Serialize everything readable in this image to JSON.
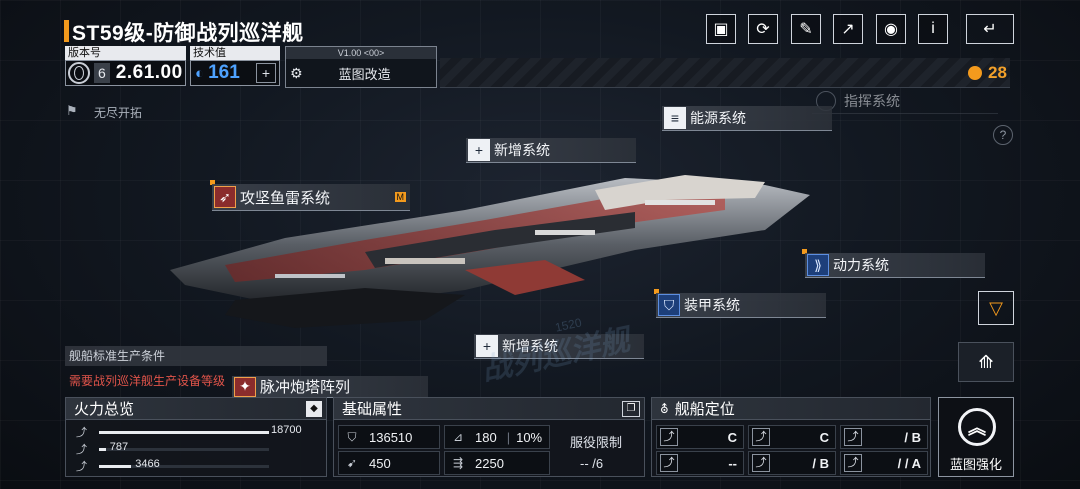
{
  "header": {
    "title": "ST59级-防御战列巡洋舰",
    "version_label": "版本号",
    "version_index": "6",
    "version_value": "2.61.00",
    "tech_label": "技术值",
    "tech_value": "161",
    "blueprint_version": "V1.00 <00>",
    "blueprint_label": "蓝图改造",
    "endless": "无尽开拓",
    "currency": "28",
    "commander_system": "指挥系统",
    "help": "?",
    "info": "i"
  },
  "systems": {
    "energy": "能源系统",
    "new1": "新增系统",
    "torpedo": "攻坚鱼雷系统",
    "torpedo_badge": "M",
    "power": "动力系统",
    "armor": "装甲系统",
    "new2": "新增系统",
    "pulse": "脉冲炮塔阵列"
  },
  "production": {
    "title": "舰船标准生产条件",
    "warning": "需要战列巡洋舰生产设备等级"
  },
  "watermark": {
    "text": "战列巡洋舰",
    "number": "1520"
  },
  "firepower": {
    "title": "火力总览",
    "rows": [
      {
        "value": "18700",
        "fraction": 1.0
      },
      {
        "value": "787",
        "fraction": 0.04
      },
      {
        "value": "3466",
        "fraction": 0.19
      }
    ]
  },
  "attributes": {
    "title": "基础属性",
    "hp": "136510",
    "armor_val": "180",
    "armor_pct": "10%",
    "speed": "450",
    "cargo": "2250",
    "service_label": "服役限制",
    "service_value": "-- /6"
  },
  "positioning": {
    "title": "舰船定位",
    "cells": [
      {
        "grade": "C"
      },
      {
        "grade": "C"
      },
      {
        "grade": "/ B"
      },
      {
        "grade": "--"
      },
      {
        "grade": "/ B"
      },
      {
        "grade": "/ / A"
      }
    ]
  },
  "enhance": {
    "label": "蓝图强化"
  }
}
